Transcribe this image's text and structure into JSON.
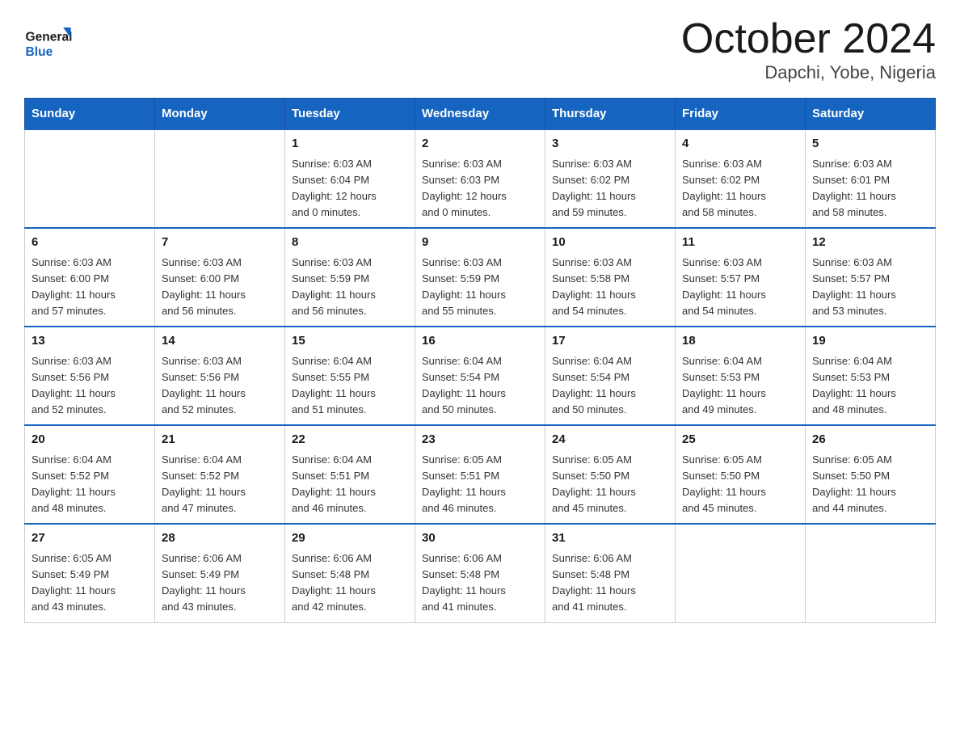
{
  "header": {
    "title": "October 2024",
    "subtitle": "Dapchi, Yobe, Nigeria"
  },
  "logo": {
    "line1": "General",
    "line2": "Blue"
  },
  "days_of_week": [
    "Sunday",
    "Monday",
    "Tuesday",
    "Wednesday",
    "Thursday",
    "Friday",
    "Saturday"
  ],
  "weeks": [
    [
      {
        "day": "",
        "info": ""
      },
      {
        "day": "",
        "info": ""
      },
      {
        "day": "1",
        "info": "Sunrise: 6:03 AM\nSunset: 6:04 PM\nDaylight: 12 hours\nand 0 minutes."
      },
      {
        "day": "2",
        "info": "Sunrise: 6:03 AM\nSunset: 6:03 PM\nDaylight: 12 hours\nand 0 minutes."
      },
      {
        "day": "3",
        "info": "Sunrise: 6:03 AM\nSunset: 6:02 PM\nDaylight: 11 hours\nand 59 minutes."
      },
      {
        "day": "4",
        "info": "Sunrise: 6:03 AM\nSunset: 6:02 PM\nDaylight: 11 hours\nand 58 minutes."
      },
      {
        "day": "5",
        "info": "Sunrise: 6:03 AM\nSunset: 6:01 PM\nDaylight: 11 hours\nand 58 minutes."
      }
    ],
    [
      {
        "day": "6",
        "info": "Sunrise: 6:03 AM\nSunset: 6:00 PM\nDaylight: 11 hours\nand 57 minutes."
      },
      {
        "day": "7",
        "info": "Sunrise: 6:03 AM\nSunset: 6:00 PM\nDaylight: 11 hours\nand 56 minutes."
      },
      {
        "day": "8",
        "info": "Sunrise: 6:03 AM\nSunset: 5:59 PM\nDaylight: 11 hours\nand 56 minutes."
      },
      {
        "day": "9",
        "info": "Sunrise: 6:03 AM\nSunset: 5:59 PM\nDaylight: 11 hours\nand 55 minutes."
      },
      {
        "day": "10",
        "info": "Sunrise: 6:03 AM\nSunset: 5:58 PM\nDaylight: 11 hours\nand 54 minutes."
      },
      {
        "day": "11",
        "info": "Sunrise: 6:03 AM\nSunset: 5:57 PM\nDaylight: 11 hours\nand 54 minutes."
      },
      {
        "day": "12",
        "info": "Sunrise: 6:03 AM\nSunset: 5:57 PM\nDaylight: 11 hours\nand 53 minutes."
      }
    ],
    [
      {
        "day": "13",
        "info": "Sunrise: 6:03 AM\nSunset: 5:56 PM\nDaylight: 11 hours\nand 52 minutes."
      },
      {
        "day": "14",
        "info": "Sunrise: 6:03 AM\nSunset: 5:56 PM\nDaylight: 11 hours\nand 52 minutes."
      },
      {
        "day": "15",
        "info": "Sunrise: 6:04 AM\nSunset: 5:55 PM\nDaylight: 11 hours\nand 51 minutes."
      },
      {
        "day": "16",
        "info": "Sunrise: 6:04 AM\nSunset: 5:54 PM\nDaylight: 11 hours\nand 50 minutes."
      },
      {
        "day": "17",
        "info": "Sunrise: 6:04 AM\nSunset: 5:54 PM\nDaylight: 11 hours\nand 50 minutes."
      },
      {
        "day": "18",
        "info": "Sunrise: 6:04 AM\nSunset: 5:53 PM\nDaylight: 11 hours\nand 49 minutes."
      },
      {
        "day": "19",
        "info": "Sunrise: 6:04 AM\nSunset: 5:53 PM\nDaylight: 11 hours\nand 48 minutes."
      }
    ],
    [
      {
        "day": "20",
        "info": "Sunrise: 6:04 AM\nSunset: 5:52 PM\nDaylight: 11 hours\nand 48 minutes."
      },
      {
        "day": "21",
        "info": "Sunrise: 6:04 AM\nSunset: 5:52 PM\nDaylight: 11 hours\nand 47 minutes."
      },
      {
        "day": "22",
        "info": "Sunrise: 6:04 AM\nSunset: 5:51 PM\nDaylight: 11 hours\nand 46 minutes."
      },
      {
        "day": "23",
        "info": "Sunrise: 6:05 AM\nSunset: 5:51 PM\nDaylight: 11 hours\nand 46 minutes."
      },
      {
        "day": "24",
        "info": "Sunrise: 6:05 AM\nSunset: 5:50 PM\nDaylight: 11 hours\nand 45 minutes."
      },
      {
        "day": "25",
        "info": "Sunrise: 6:05 AM\nSunset: 5:50 PM\nDaylight: 11 hours\nand 45 minutes."
      },
      {
        "day": "26",
        "info": "Sunrise: 6:05 AM\nSunset: 5:50 PM\nDaylight: 11 hours\nand 44 minutes."
      }
    ],
    [
      {
        "day": "27",
        "info": "Sunrise: 6:05 AM\nSunset: 5:49 PM\nDaylight: 11 hours\nand 43 minutes."
      },
      {
        "day": "28",
        "info": "Sunrise: 6:06 AM\nSunset: 5:49 PM\nDaylight: 11 hours\nand 43 minutes."
      },
      {
        "day": "29",
        "info": "Sunrise: 6:06 AM\nSunset: 5:48 PM\nDaylight: 11 hours\nand 42 minutes."
      },
      {
        "day": "30",
        "info": "Sunrise: 6:06 AM\nSunset: 5:48 PM\nDaylight: 11 hours\nand 41 minutes."
      },
      {
        "day": "31",
        "info": "Sunrise: 6:06 AM\nSunset: 5:48 PM\nDaylight: 11 hours\nand 41 minutes."
      },
      {
        "day": "",
        "info": ""
      },
      {
        "day": "",
        "info": ""
      }
    ]
  ]
}
